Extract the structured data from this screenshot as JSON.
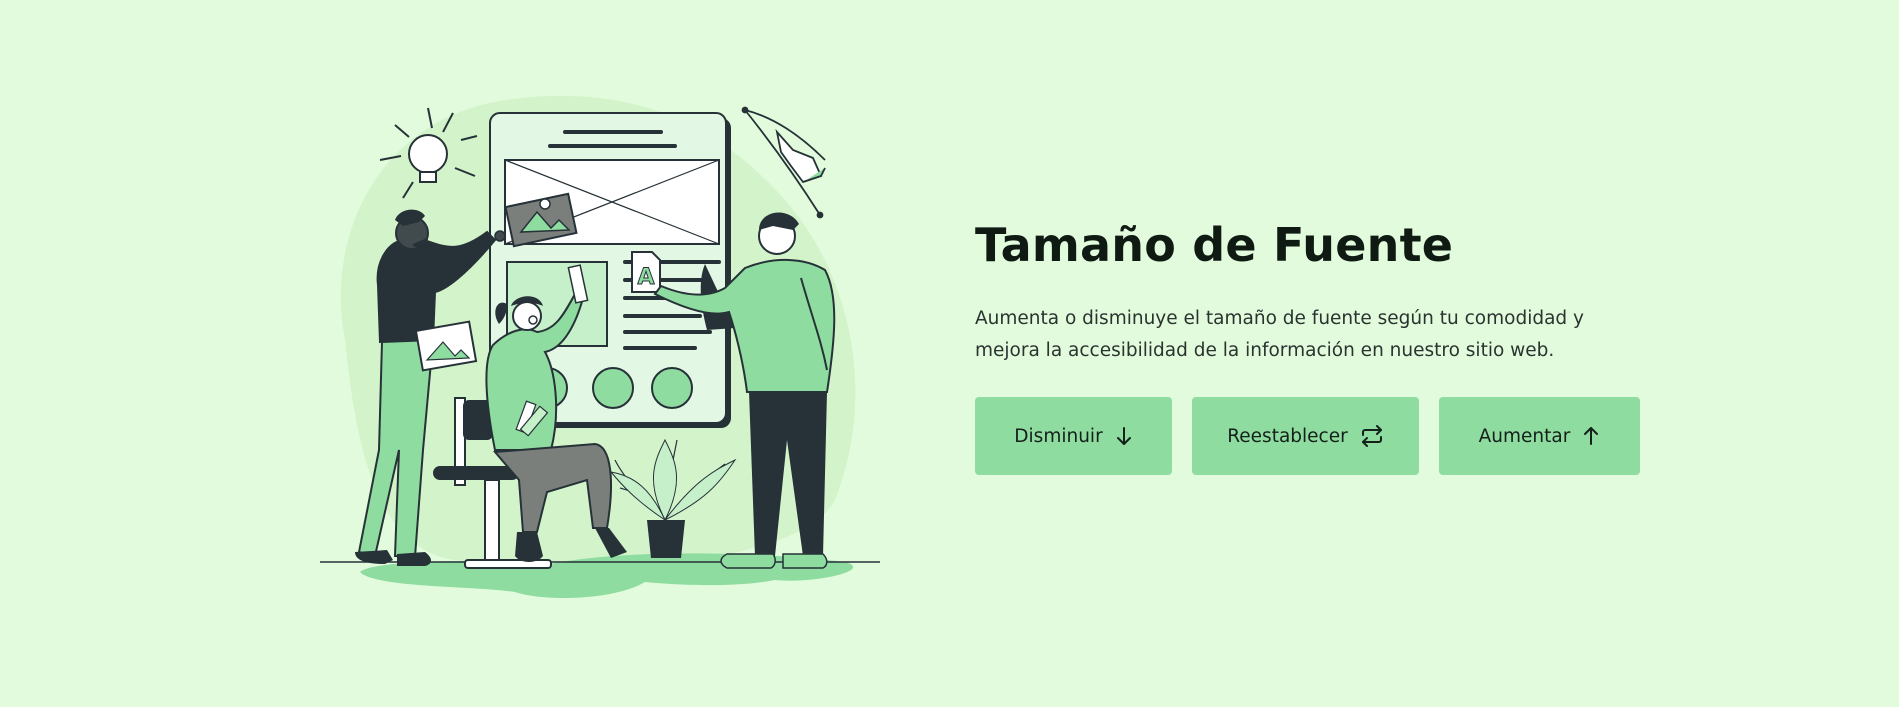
{
  "section": {
    "title": "Tamaño de Fuente",
    "description": "Aumenta o disminuye el tamaño de fuente según tu comodidad y mejora la accesibilidad de la información en nuestro sitio web."
  },
  "buttons": {
    "decrease": {
      "label": "Disminuir",
      "icon": "arrow-down-icon"
    },
    "reset": {
      "label": "Reestablecer",
      "icon": "repeat-icon"
    },
    "increase": {
      "label": "Aumentar",
      "icon": "arrow-up-icon"
    }
  },
  "illustration": {
    "letter_card": "A"
  },
  "colors": {
    "background": "#e2fbdc",
    "button": "#8fdca0",
    "illustration_green": "#8fdca0",
    "illustration_dark": "#263238"
  }
}
